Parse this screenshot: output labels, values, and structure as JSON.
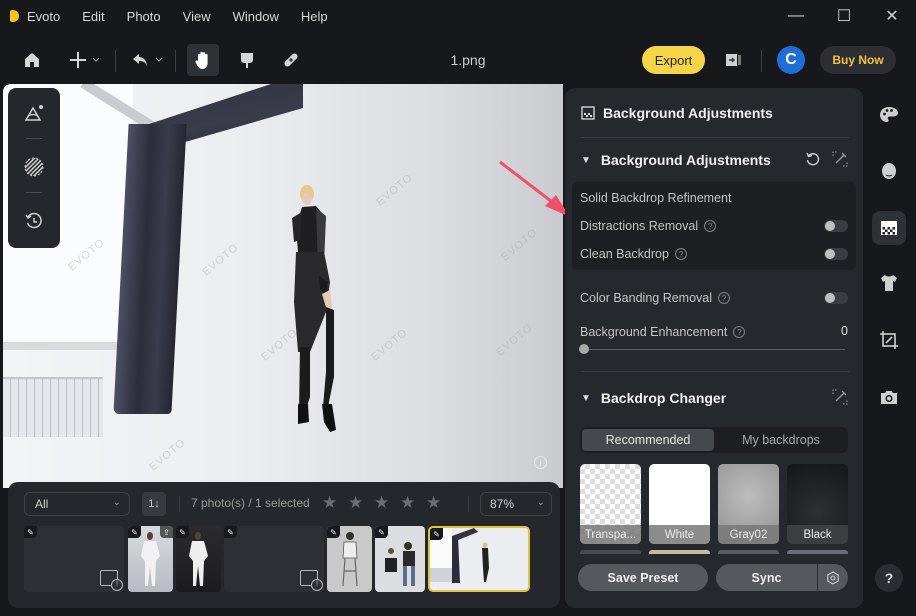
{
  "app": {
    "name": "Evoto",
    "accent": "#f6d548"
  },
  "menu": [
    "Evoto",
    "Edit",
    "Photo",
    "View",
    "Window",
    "Help"
  ],
  "window_controls": {
    "minimize": "—",
    "maximize": "☐",
    "close": "✕"
  },
  "toolbar": {
    "home_icon": "home-icon",
    "add_icon": "plus-icon",
    "undo_icon": "undo-icon",
    "tools": [
      "hand-tool-icon",
      "retouch-finger-icon",
      "bandage-heal-icon"
    ],
    "document_title": "1.png",
    "export_label": "Export",
    "compare_icon": "compare-panel-icon",
    "avatar_initial": "C",
    "buy_now_label": "Buy Now"
  },
  "canvas": {
    "watermark": "EVOTO",
    "info_icon": "i"
  },
  "floating_tools": [
    "scene-icon",
    "mask-brush-icon",
    "history-icon"
  ],
  "filmstrip": {
    "filter_value": "All",
    "sort_icon": "1↓",
    "count_text": "7 photo(s) / 1 selected",
    "rating_stars": 5,
    "rating_value": 0,
    "zoom_value": "87%",
    "thumbnails": [
      {
        "type": "missing",
        "edited": true
      },
      {
        "type": "photo",
        "edited": true,
        "uploaded": true,
        "desc": "woman in white suit, grey backdrop"
      },
      {
        "type": "photo",
        "edited": true,
        "desc": "woman in white suit, dark backdrop"
      },
      {
        "type": "missing",
        "edited": true
      },
      {
        "type": "photo",
        "edited": true,
        "desc": "sketch-style woman on stool"
      },
      {
        "type": "photo",
        "edited": true,
        "desc": "photographer shooting seated model"
      },
      {
        "type": "photo",
        "edited": true,
        "selected": true,
        "desc": "model in black dress, studio with curtain"
      }
    ]
  },
  "panel": {
    "title": "Background Adjustments",
    "section1": {
      "title": "Background Adjustments",
      "subgroup_title": "Solid Backdrop Refinement",
      "options": [
        {
          "label": "Distractions Removal",
          "help": "?",
          "enabled": false
        },
        {
          "label": "Clean Backdrop",
          "help": "?",
          "enabled": false
        }
      ],
      "color_banding": {
        "label": "Color Banding Removal",
        "help": "?",
        "enabled": false
      },
      "enhancement": {
        "label": "Background Enhancement",
        "help": "?",
        "value": "0",
        "slider_fraction": 0
      }
    },
    "section2": {
      "title": "Backdrop Changer",
      "tabs": [
        "Recommended",
        "My backdrops"
      ],
      "active_tab": "Recommended",
      "backdrops": [
        "Transpa...",
        "White",
        "Gray02",
        "Black"
      ]
    },
    "save_preset_label": "Save Preset",
    "sync_label": "Sync"
  },
  "rail": [
    "palette-icon",
    "face-icon",
    "background-icon",
    "clothing-icon",
    "crop-icon",
    "camera-icon"
  ],
  "help_label": "?"
}
